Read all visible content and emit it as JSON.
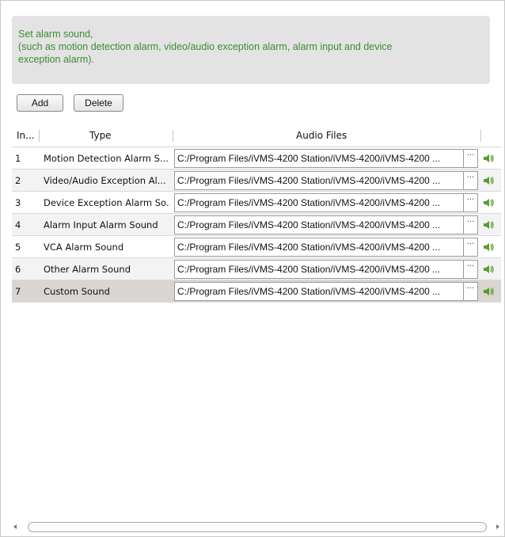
{
  "info": {
    "line1": "Set alarm sound,",
    "line2": "(such as motion detection alarm, video/audio exception alarm, alarm input and device",
    "line3": "exception alarm)."
  },
  "toolbar": {
    "add_label": "Add",
    "delete_label": "Delete"
  },
  "table": {
    "columns": {
      "index": "In...",
      "type": "Type",
      "audio": "Audio Files"
    },
    "rows": [
      {
        "index": "1",
        "type": "Motion Detection Alarm S...",
        "path": "C:/Program Files/iVMS-4200 Station/iVMS-4200/iVMS-4200 ...",
        "browse": "···"
      },
      {
        "index": "2",
        "type": "Video/Audio Exception Al...",
        "path": "C:/Program Files/iVMS-4200 Station/iVMS-4200/iVMS-4200 ...",
        "browse": "···"
      },
      {
        "index": "3",
        "type": "Device Exception Alarm So...",
        "path": "C:/Program Files/iVMS-4200 Station/iVMS-4200/iVMS-4200 ...",
        "browse": "···"
      },
      {
        "index": "4",
        "type": "Alarm Input Alarm Sound",
        "path": "C:/Program Files/iVMS-4200 Station/iVMS-4200/iVMS-4200 ...",
        "browse": "···"
      },
      {
        "index": "5",
        "type": "VCA Alarm Sound",
        "path": "C:/Program Files/iVMS-4200 Station/iVMS-4200/iVMS-4200 ...",
        "browse": "···"
      },
      {
        "index": "6",
        "type": "Other Alarm Sound",
        "path": "C:/Program Files/iVMS-4200 Station/iVMS-4200/iVMS-4200 ...",
        "browse": "···"
      },
      {
        "index": "7",
        "type": "Custom Sound",
        "path": "C:/Program Files/iVMS-4200 Station/iVMS-4200/iVMS-4200 ...",
        "browse": "···"
      }
    ],
    "selected_row_index": 7
  },
  "icons": {
    "play_sound": "speaker-icon",
    "scroll_left": "arrow-left-icon",
    "scroll_right": "arrow-right-icon"
  },
  "colors": {
    "info_text": "#3d8a35",
    "info_bg": "#e3e3e3",
    "selected_row": "#dad5d0",
    "speaker_green": "#5a9a2e"
  }
}
